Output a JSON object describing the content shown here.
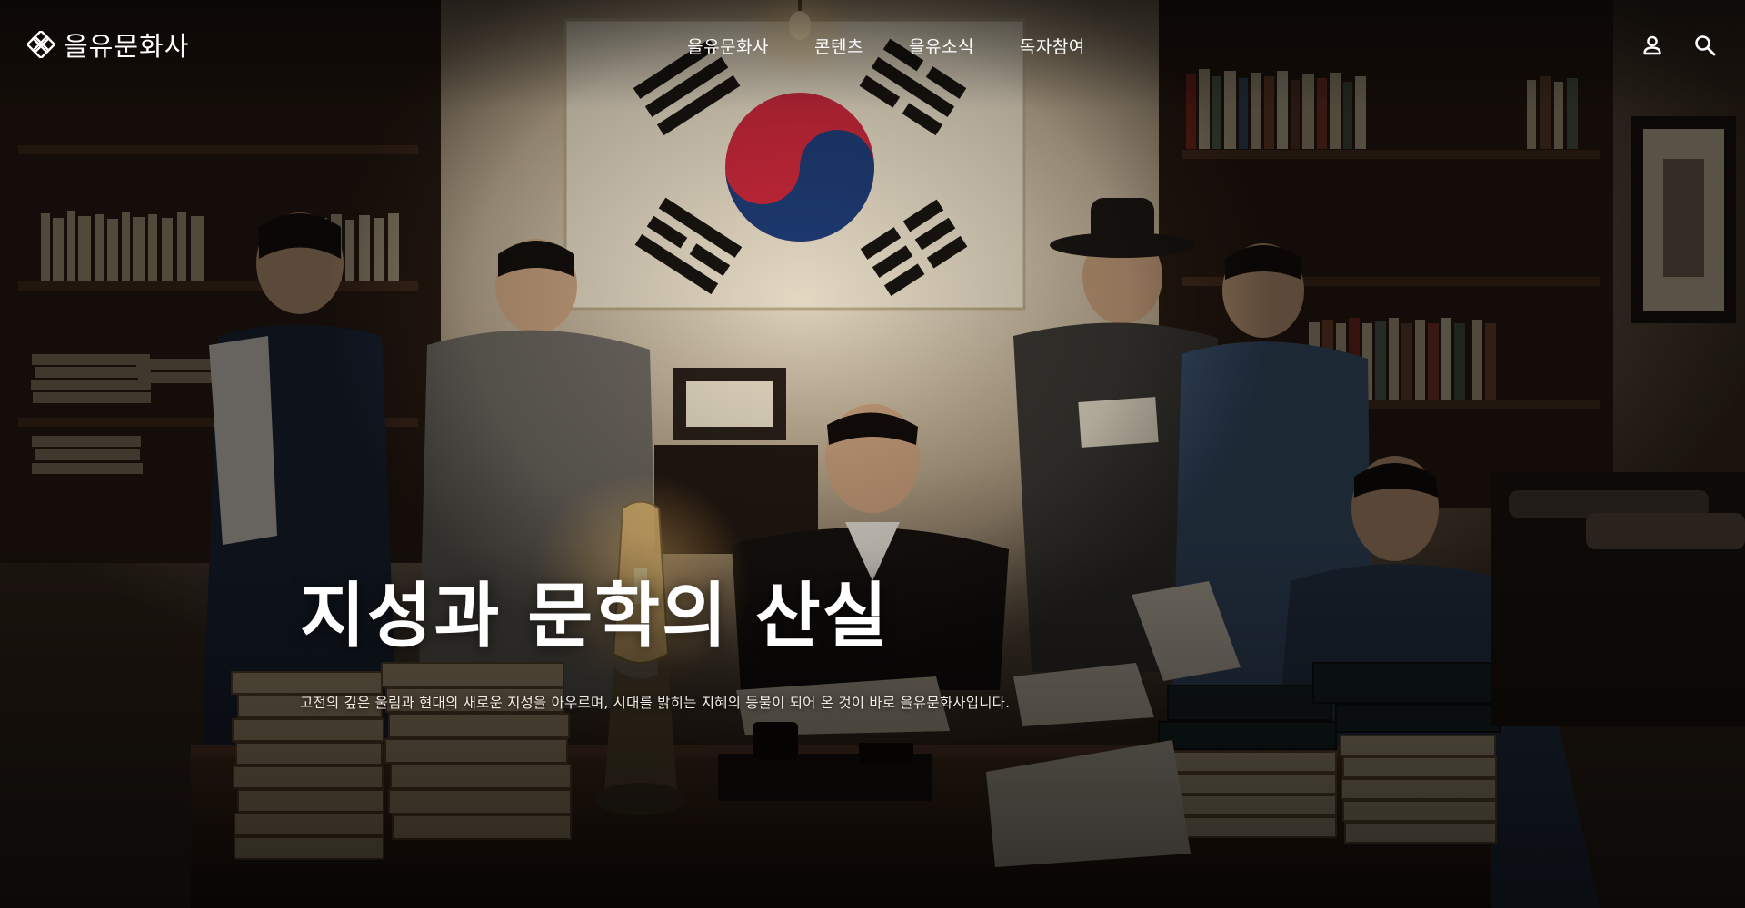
{
  "brand": {
    "name": "을유문화사",
    "logo_icon": "diamond-knot-icon"
  },
  "nav": {
    "items": [
      {
        "label": "을유문화사"
      },
      {
        "label": "콘텐츠"
      },
      {
        "label": "을유소식"
      },
      {
        "label": "독자참여"
      }
    ]
  },
  "utility": {
    "account_icon": "user-icon",
    "search_icon": "search-icon"
  },
  "hero": {
    "title": "지성과 문학의 산실",
    "description": "고전의 깊은 울림과 현대의 새로운 지성을 아우르며, 시대를 밝히는 지혜의 등불이 되어 온 것이 바로 을유문화사입니다.",
    "image_icon": "hero-photo-publishing-office"
  },
  "colors": {
    "text": "#ffffff",
    "flag_red": "#c8283a",
    "flag_blue": "#1e3b73",
    "wall": "#cdbfa6",
    "wood": "#3a261a"
  }
}
